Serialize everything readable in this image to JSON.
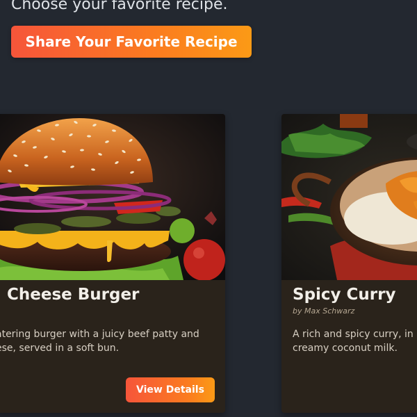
{
  "header": {
    "subtitle": "Choose your favorite recipe.",
    "share_button_label": "Share Your Favorite Recipe"
  },
  "recipes": [
    {
      "title": "Cheese Burger",
      "description_line1": "atering burger with a juicy beef patty and",
      "description_line2": "ese, served in a soft bun.",
      "button_label": "View Details"
    },
    {
      "title": "Spicy Curry",
      "author": "by Max Schwarz",
      "description_line1": "A rich and spicy curry, in",
      "description_line2": "creamy coconut milk."
    }
  ],
  "colors": {
    "background": "#232830",
    "card": "#2a231b",
    "accent_start": "#f6553a",
    "accent_end": "#fb9a16"
  }
}
